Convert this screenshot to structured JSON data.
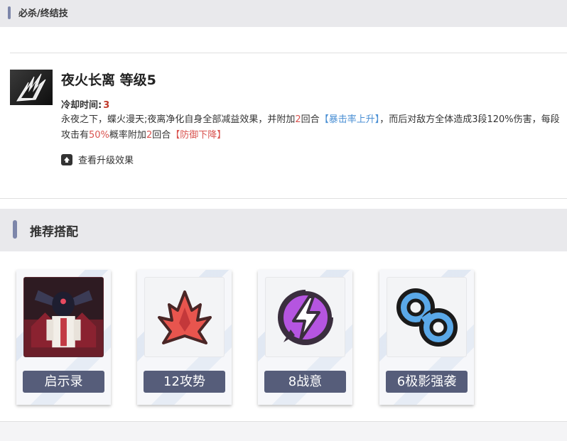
{
  "section_ult": {
    "title": "必杀/终结技"
  },
  "skill": {
    "icon": "dark-claw-icon",
    "name": "夜火长离 等级5",
    "cooldown_label": "冷却时间:",
    "cooldown_value": "3",
    "desc": {
      "p1": "永夜之下，蝶火漫天;夜离净化自身全部减益效果，并附加",
      "n1": "2",
      "p2": "回合",
      "buff": "【暴击率上升】",
      "p3": "，而后对敌方全体造成3段120%伤害，每段攻击有",
      "chance": "50%",
      "p4": "概率附加",
      "n2": "2",
      "p5": "回合",
      "debuff": "【防御下降】"
    },
    "upgrade_label": "查看升级效果",
    "upgrade_icon": "upload-arrow-icon"
  },
  "section_reco": {
    "title": "推荐搭配"
  },
  "cards": [
    {
      "label": "启示录",
      "icon": "character-portrait"
    },
    {
      "label": "12攻势",
      "icon": "red-spike-icon"
    },
    {
      "label": "8战意",
      "icon": "purple-lightning-icon"
    },
    {
      "label": "6极影强袭",
      "icon": "blue-rings-icon"
    }
  ],
  "colors": {
    "accent": "#7d86aa",
    "label_bg": "#565d7a",
    "cooldown_red": "#c0392b",
    "buff_blue": "#4a8fd4",
    "debuff_red": "#d9534f"
  }
}
